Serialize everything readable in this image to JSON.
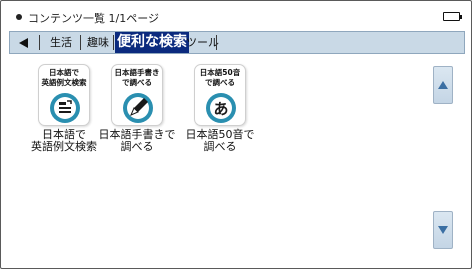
{
  "status": {
    "title": "コンテンツ一覧 1/1ページ",
    "battery_icon": "battery-full-icon"
  },
  "tabs": {
    "back_icon": "back-arrow-icon",
    "items": [
      {
        "label": "生活",
        "active": false
      },
      {
        "label": "趣味",
        "active": false
      },
      {
        "label": "便利な検索",
        "active": true
      },
      {
        "label": "ツール",
        "active": false
      }
    ]
  },
  "apps": [
    {
      "icon_text": "日本語で\n英語例文検索",
      "label": "日本語で\n英語例文検索",
      "icon": "document-search-icon",
      "accent": "#2a8fb0"
    },
    {
      "icon_text": "日本語手書き\nで調べる",
      "label": "日本語手書きで\n調べる",
      "icon": "pen-write-icon",
      "accent": "#2a8fb0"
    },
    {
      "icon_text": "日本語50音\nで調べる",
      "label": "日本語50音で\n調べる",
      "icon": "hiragana-a-icon",
      "accent": "#2a8fb0"
    }
  ],
  "scroll": {
    "up_icon": "scroll-up-icon",
    "down_icon": "scroll-down-icon"
  },
  "colors": {
    "tab_bar_bg": "#c9d9e6",
    "tab_active_bg": "#0b2a7e",
    "icon_accent": "#2a8fb0"
  }
}
